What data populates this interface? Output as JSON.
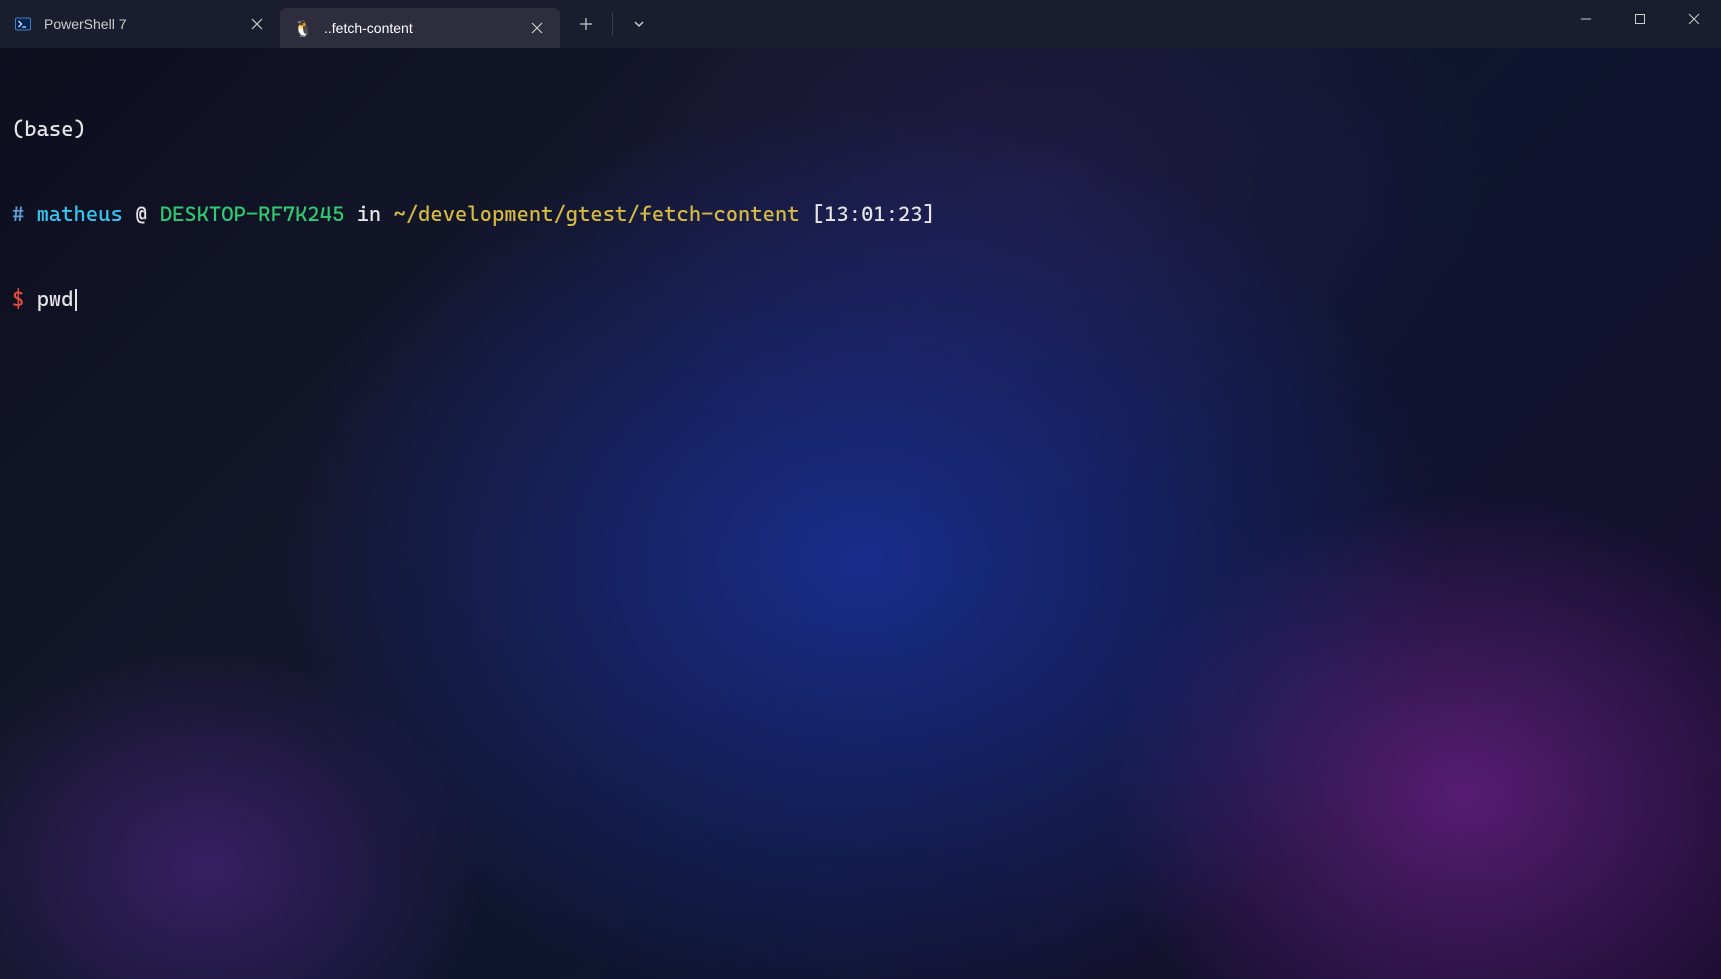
{
  "tabs": [
    {
      "title": "PowerShell 7",
      "icon": "powershell",
      "active": false
    },
    {
      "title": "..fetch-content",
      "icon": "tux",
      "active": true
    }
  ],
  "terminal": {
    "env_line": "(base)",
    "prompt_hash": "#",
    "username": "matheus",
    "at_symbol": "@",
    "hostname": "DESKTOP-RF7K245",
    "in_word": "in",
    "path": "~/development/gtest/fetch-content",
    "timestamp": "[13:01:23]",
    "prompt_symbol": "$",
    "command": "pwd"
  },
  "colors": {
    "white": "#e5e5e5",
    "blue": "#5b9dd9",
    "cyan": "#36c5f0",
    "green": "#2ecc71",
    "yellow": "#d4b943",
    "red": "#e74c3c"
  }
}
